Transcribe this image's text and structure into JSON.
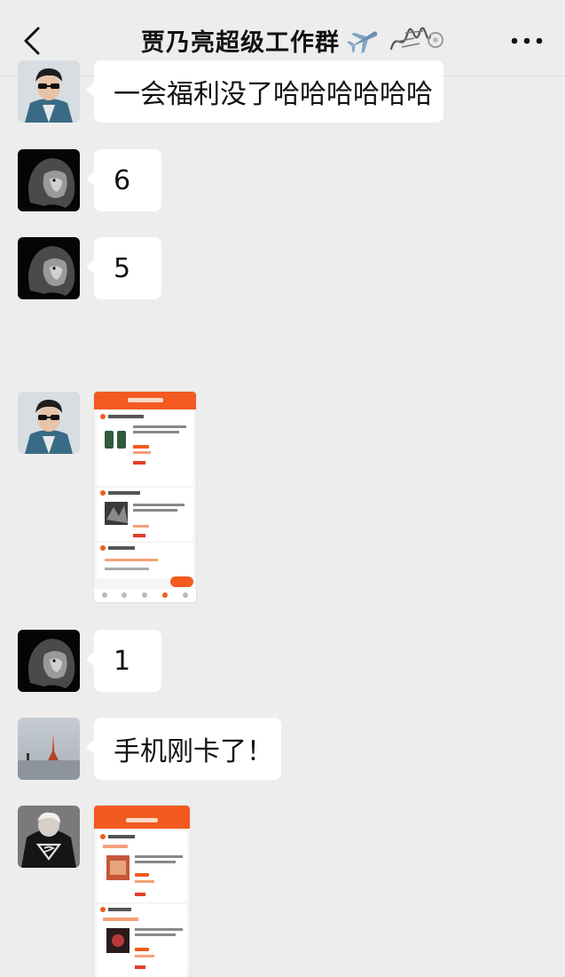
{
  "header": {
    "title": "贾乃亮超级工作群",
    "title_icons": [
      "airplane-icon",
      "scribble-sticker-icon"
    ],
    "back_icon": "chevron-left-icon",
    "more_icon": "more-dots-icon"
  },
  "messages": [
    {
      "sender_avatar": "man-sunglasses-avatar",
      "type": "text",
      "text": "一会福利没了哈哈哈哈哈哈"
    },
    {
      "sender_avatar": "lion-avatar",
      "type": "text",
      "text": "6"
    },
    {
      "sender_avatar": "lion-avatar",
      "type": "text",
      "text": "5"
    },
    {
      "sender_avatar": "man-sunglasses-avatar",
      "type": "image",
      "image": "shopping-app-screenshot"
    },
    {
      "sender_avatar": "lion-avatar",
      "type": "text",
      "text": "1"
    },
    {
      "sender_avatar": "tower-landscape-avatar",
      "type": "text",
      "text": "手机刚卡了！"
    },
    {
      "sender_avatar": "superman-hoodie-avatar",
      "type": "image",
      "image": "shopping-app-screenshot"
    }
  ],
  "colors": {
    "background": "#ededed",
    "bubble": "#ffffff",
    "screenshot_orange": "#f25a1f"
  }
}
